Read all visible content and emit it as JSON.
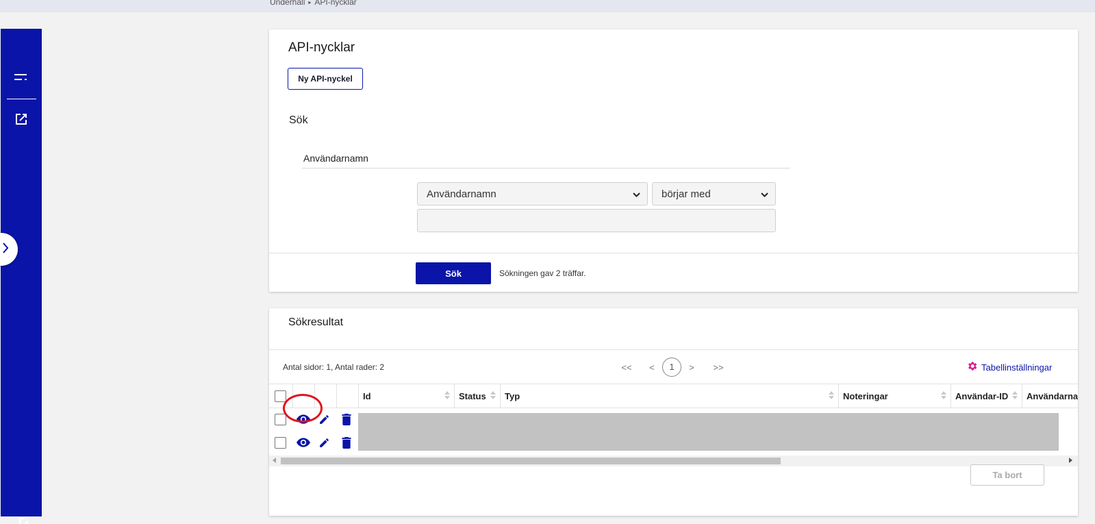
{
  "breadcrumb": {
    "items": [
      "Underhåll",
      "API-nycklar"
    ],
    "separator": "▸"
  },
  "sidebar": {
    "icons": [
      "menu-icon",
      "open-external-icon",
      "logout-icon"
    ],
    "background": "#0a14a8",
    "expand_icon": "chevron-right-icon"
  },
  "search_card": {
    "title": "API-nycklar",
    "new_button": "Ny API-nyckel",
    "search_heading": "Sök",
    "field_label": "Användarnamn",
    "field_select": {
      "selected": "Användarnamn"
    },
    "operator_select": {
      "selected": "börjar med"
    },
    "value_input": {
      "value": "",
      "placeholder": ""
    },
    "search_button": "Sök",
    "result_message": "Sökningen gav 2 träffar."
  },
  "results_card": {
    "title": "Sökresultat",
    "page_info": "Antal sidor: 1, Antal rader: 2",
    "pagination": {
      "first": "<<",
      "prev": "<",
      "current": "1",
      "next": ">",
      "last": ">>"
    },
    "table_settings": "Tabellinställningar",
    "columns": [
      "Id",
      "Status",
      "Typ",
      "Noteringar",
      "Användar-ID",
      "Användarnamn"
    ],
    "rows": [
      {
        "actions": [
          "view-icon",
          "edit-icon",
          "delete-icon"
        ],
        "data_redacted": true
      },
      {
        "actions": [
          "view-icon",
          "edit-icon",
          "delete-icon"
        ],
        "data_redacted": true
      }
    ],
    "delete_button": "Ta bort"
  },
  "colors": {
    "brand": "#0a14a8",
    "accent": "#d81b8a",
    "highlight": "#e0141e"
  }
}
